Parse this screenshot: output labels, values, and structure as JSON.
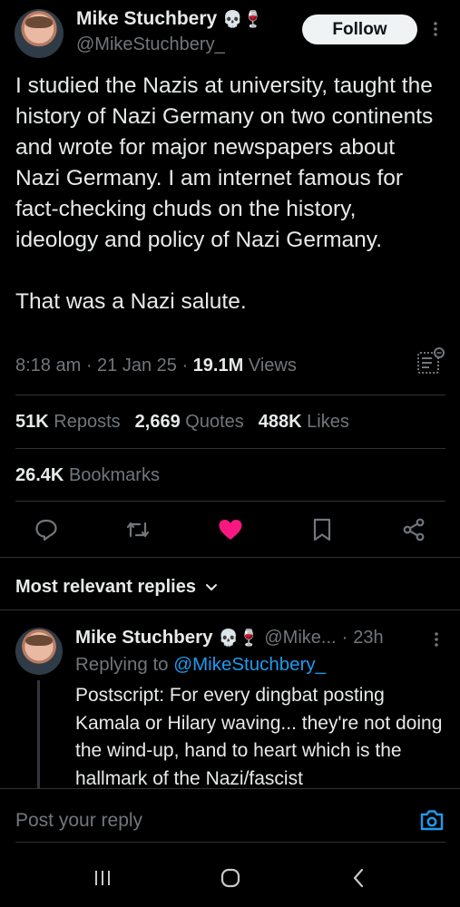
{
  "author": {
    "name": "Mike Stuchbery",
    "emojis": "💀🍷",
    "handle": "@MikeStuchbery_"
  },
  "follow_label": "Follow",
  "tweet": {
    "text": "I studied the Nazis at university, taught the history of Nazi Germany on two continents and wrote for major newspapers about Nazi Germany. I am internet famous for fact-checking chuds on the history, ideology and policy of Nazi Germany.\n\nThat was a Nazi salute.",
    "time": "8:18 am",
    "date": "21 Jan 25",
    "views_count": "19.1M",
    "views_label": "Views"
  },
  "stats": {
    "reposts_count": "51K",
    "reposts_label": "Reposts",
    "quotes_count": "2,669",
    "quotes_label": "Quotes",
    "likes_count": "488K",
    "likes_label": "Likes",
    "bookmarks_count": "26.4K",
    "bookmarks_label": "Bookmarks"
  },
  "replies_header": "Most relevant replies",
  "reply": {
    "name": "Mike Stuchbery",
    "emojis": "💀🍷",
    "handle_short": "@Mike...",
    "time": "23h",
    "replying_to_label": "Replying to",
    "replying_to_handle": "@MikeStuchbery_",
    "text": "Postscript: For every dingbat posting Kamala or Hilary waving... they're not doing the wind-up, hand to heart which is the hallmark of the Nazi/fascist"
  },
  "composer": {
    "placeholder": "Post your reply"
  },
  "colors": {
    "background": "#000000",
    "like_active": "#f91880",
    "accent_blue": "#1d9bf0",
    "muted": "#71767b"
  },
  "icons": [
    "more-icon",
    "analytics-icon",
    "reply-icon",
    "repost-icon",
    "like-icon",
    "bookmark-icon",
    "share-icon",
    "chevron-down-icon",
    "camera-icon",
    "recents-icon",
    "home-icon",
    "back-icon"
  ]
}
